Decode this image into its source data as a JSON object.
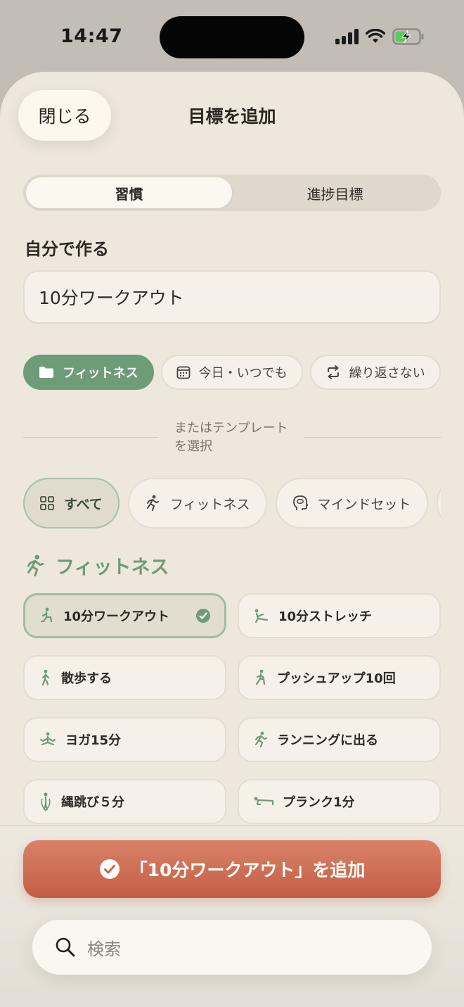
{
  "status_bar": {
    "time": "14:47"
  },
  "header": {
    "close_label": "閉じる",
    "title": "目標を追加"
  },
  "segment": {
    "tabs": [
      "習慣",
      "進捗目標"
    ],
    "active": 0
  },
  "custom": {
    "label": "自分で作る",
    "input_value": "10分ワークアウト"
  },
  "options": {
    "category": "フィットネス",
    "schedule": "今日・いつでも",
    "repeat": "繰り返さない"
  },
  "template_divider": {
    "line1": "またはテンプレート",
    "line2": "を選択"
  },
  "categories": [
    "すべて",
    "フィットネス",
    "マインドセット"
  ],
  "group": {
    "title": "フィットネス"
  },
  "templates": [
    {
      "label": "10分ワークアウト",
      "icon": "workout-icon",
      "selected": true
    },
    {
      "label": "10分ストレッチ",
      "icon": "stretch-icon"
    },
    {
      "label": "散歩する",
      "icon": "walk-icon"
    },
    {
      "label": "プッシュアップ10回",
      "icon": "pushup-icon"
    },
    {
      "label": "ヨガ15分",
      "icon": "yoga-icon"
    },
    {
      "label": "ランニングに出る",
      "icon": "run-icon"
    },
    {
      "label": "縄跳び５分",
      "icon": "jumprope-icon"
    },
    {
      "label": "プランク1分",
      "icon": "plank-icon"
    }
  ],
  "cta": {
    "label": "「10分ワークアウト」を追加"
  },
  "search": {
    "placeholder": "検索"
  },
  "colors": {
    "accent_green": "#6f9c78",
    "cta": "#c9654b",
    "sheet_bg": "#ede7dc"
  }
}
